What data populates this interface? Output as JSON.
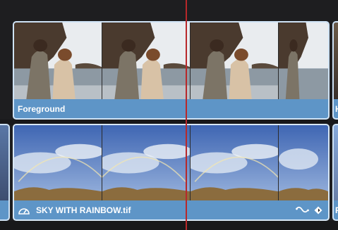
{
  "timeline": {
    "tracks": [
      {
        "id": "video-2",
        "clip": {
          "name": "Foreground",
          "color": "#5e95c7",
          "thumbnail": "beach-couple"
        },
        "next_clip": {
          "partial_label": "H"
        }
      },
      {
        "id": "video-1",
        "clip": {
          "name": "SKY WITH RAINBOW.tif",
          "color": "#5e95c7",
          "thumbnail": "sky-rainbow",
          "left_icon": "speed-gauge-icon",
          "right_icons": [
            "curve-icon",
            "keyframe-diamond-icon"
          ]
        },
        "next_clip": {
          "partial_label": "F"
        }
      }
    ],
    "playhead_color": "#b8282a"
  }
}
